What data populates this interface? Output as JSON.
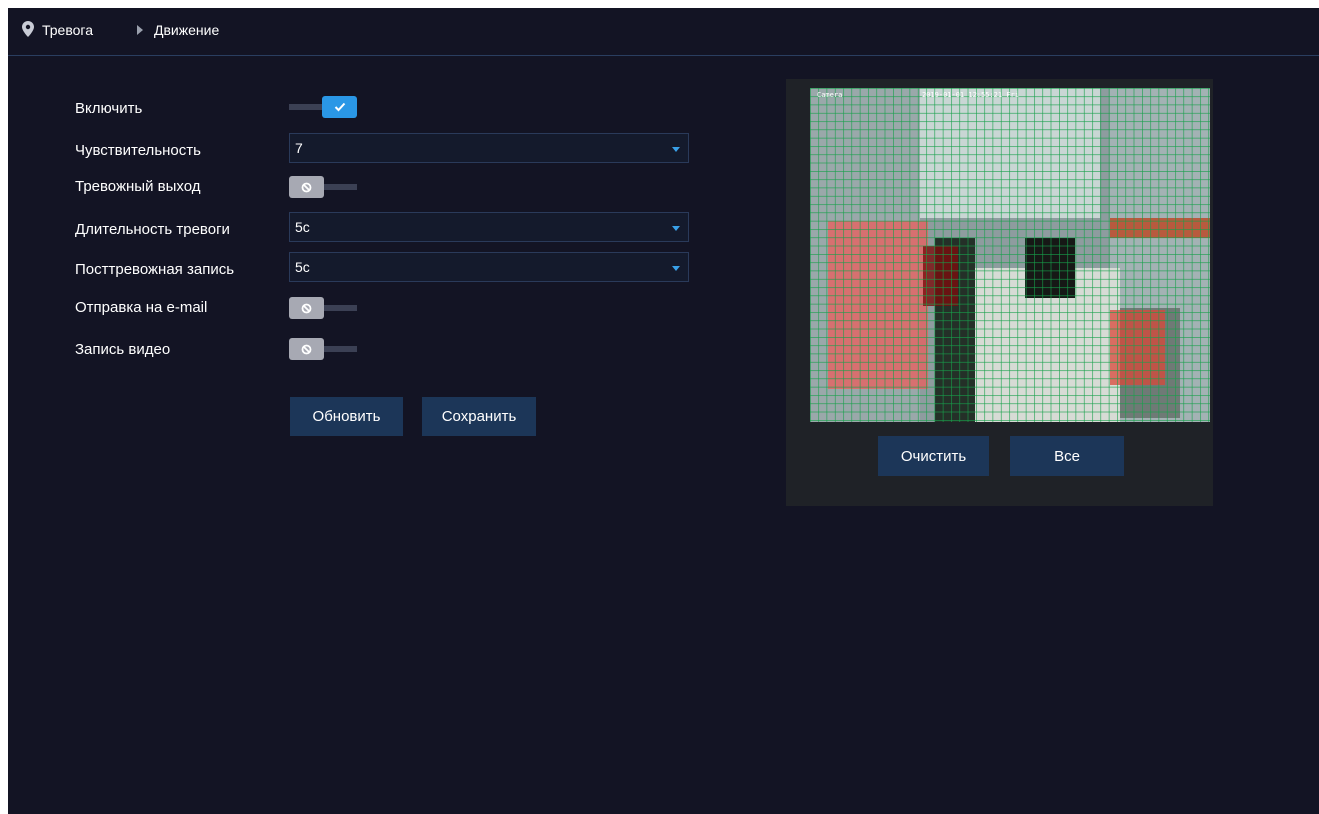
{
  "breadcrumb": {
    "section": "Тревога",
    "page": "Движение"
  },
  "form": {
    "enable": {
      "label": "Включить",
      "state": "on"
    },
    "sensitivity": {
      "label": "Чувствительность",
      "value": "7"
    },
    "alarm_output": {
      "label": "Тревожный выход",
      "state": "off"
    },
    "alarm_duration": {
      "label": "Длительность тревоги",
      "value": "5с"
    },
    "post_alarm_record": {
      "label": "Посттревожная запись",
      "value": "5с"
    },
    "send_email": {
      "label": "Отправка на e-mail",
      "state": "off"
    },
    "record_video": {
      "label": "Запись видео",
      "state": "off"
    }
  },
  "buttons": {
    "refresh": "Обновить",
    "save": "Сохранить",
    "clear": "Очистить",
    "all": "Все"
  },
  "preview": {
    "osd_camera": "Camera",
    "osd_timestamp": "2019-01-01 12:55:21 Fri"
  },
  "colors": {
    "background": "#131424",
    "accent": "#2a97e6",
    "button": "#1c3658",
    "grid": "#16a04a",
    "detection_zone": "#e86060"
  }
}
